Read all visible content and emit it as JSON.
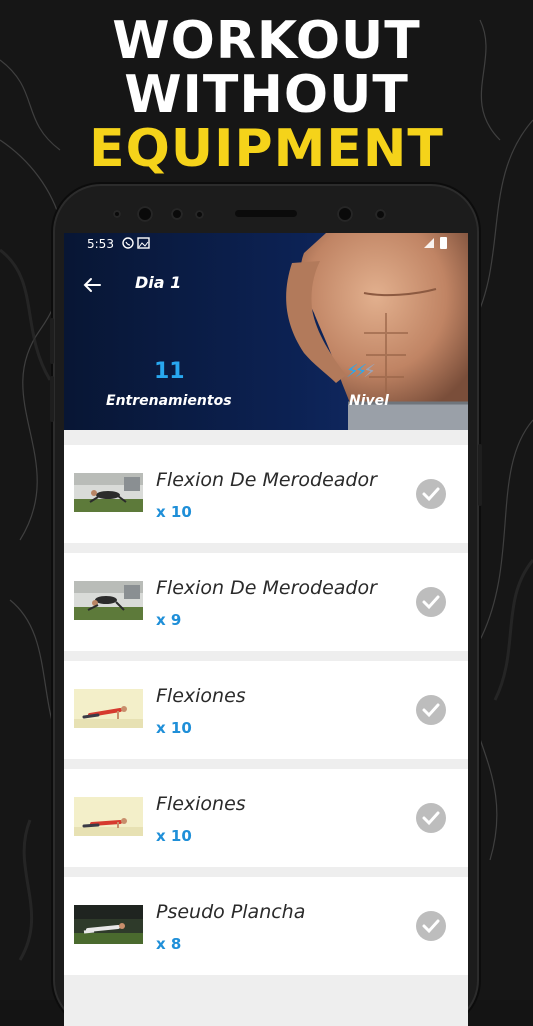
{
  "promo": {
    "line1": "WORKOUT",
    "line2": "WITHOUT",
    "line3": "EQUIPMENT"
  },
  "status_bar": {
    "time": "5:53"
  },
  "header": {
    "title": "Dia 1",
    "workouts_count": "11",
    "workouts_label": "Entrenamientos",
    "level_label": "Nivel"
  },
  "exercises": [
    {
      "name": "Flexion De Merodeador",
      "reps": "x 10"
    },
    {
      "name": "Flexion De Merodeador",
      "reps": "x 9"
    },
    {
      "name": "Flexiones",
      "reps": "x 10"
    },
    {
      "name": "Flexiones",
      "reps": "x 10"
    },
    {
      "name": "Pseudo Plancha",
      "reps": "x 8"
    }
  ],
  "colors": {
    "accent_yellow": "#f5d31a",
    "accent_blue": "#1f8fd8",
    "hero_bg": "#0c2152"
  }
}
